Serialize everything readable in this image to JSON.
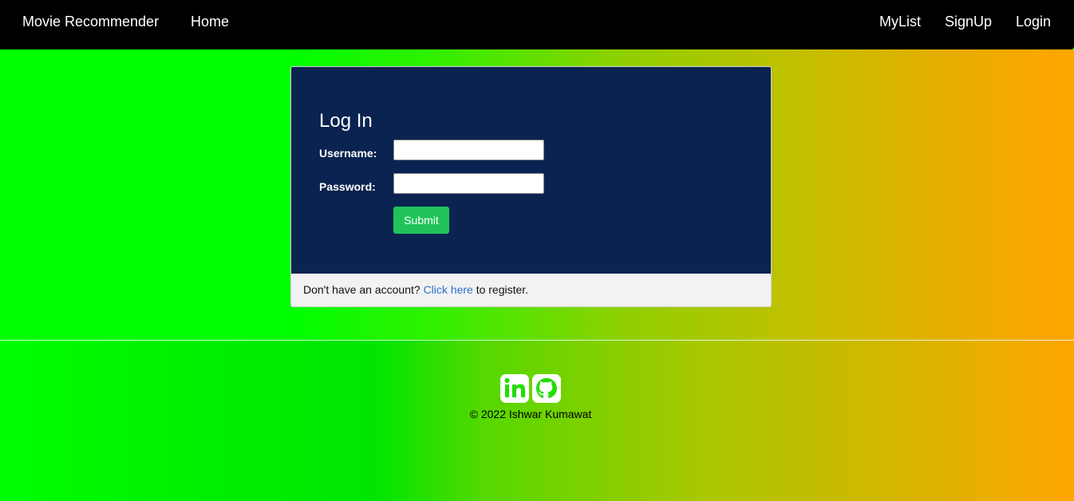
{
  "navbar": {
    "brand": "Movie Recommender",
    "home": "Home",
    "mylist": "MyList",
    "signup": "SignUp",
    "login": "Login"
  },
  "login_card": {
    "title": "Log In",
    "username_label": "Username:",
    "username_value": "",
    "password_label": "Password:",
    "password_value": "",
    "submit_label": "Submit",
    "footer_prefix": "Don't have an account?",
    "footer_link": "Click here",
    "footer_suffix": "to register."
  },
  "footer": {
    "icons": [
      "linkedin-icon",
      "github-icon"
    ],
    "copyright": "© 2022 Ishwar Kumawat"
  },
  "colors": {
    "navbar": "#000000",
    "card_body": "#0b2350",
    "submit": "#20c35a",
    "link": "#2f6fd0",
    "gradient_start": "#00ff00",
    "gradient_end": "#ffa500"
  }
}
